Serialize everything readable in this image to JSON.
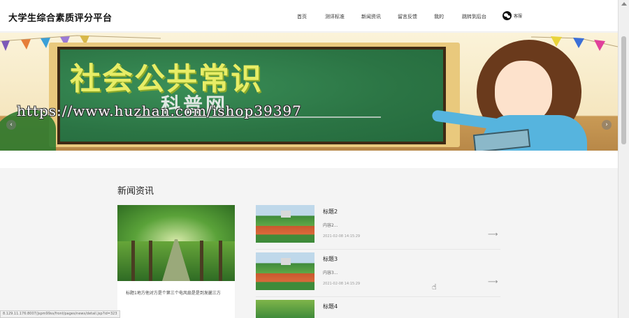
{
  "header": {
    "brand": "大学生综合素质评分平台",
    "nav": [
      {
        "label": "首页"
      },
      {
        "label": "测评标准"
      },
      {
        "label": "新闻资讯"
      },
      {
        "label": "留言反馈"
      },
      {
        "label": "我的"
      },
      {
        "label": "跳转到后台"
      }
    ],
    "wechat_label": "客服"
  },
  "banner": {
    "board_title": "社会公共常识",
    "board_subtitle": "科普网",
    "watermark": "https://www.huzhan.com/ishop39397",
    "prev_glyph": "‹",
    "next_glyph": "›",
    "slide_count": 3,
    "active_slide": 0
  },
  "news": {
    "section_title": "新闻资讯",
    "feature_text": "标题1地方他对方是个第三个电风扇是是到发麗三方",
    "items": [
      {
        "title": "标题2",
        "content": "内容2...",
        "date": "2021-02-08 14:15:29",
        "arrow": "⟶"
      },
      {
        "title": "标题3",
        "content": "内容3...",
        "date": "2021-02-08 14:15:29",
        "arrow": "⟶"
      },
      {
        "title": "标题4",
        "content": "",
        "date": "",
        "arrow": ""
      }
    ]
  },
  "status_bar": {
    "url": "8.129.11.176:8007/jspm99ss/front/pages/news/detail.jsp?id=323"
  },
  "colors": {
    "board_green": "#2e7d4a",
    "title_yellow": "#e8ed66",
    "teacher_blue": "#56b4de"
  }
}
